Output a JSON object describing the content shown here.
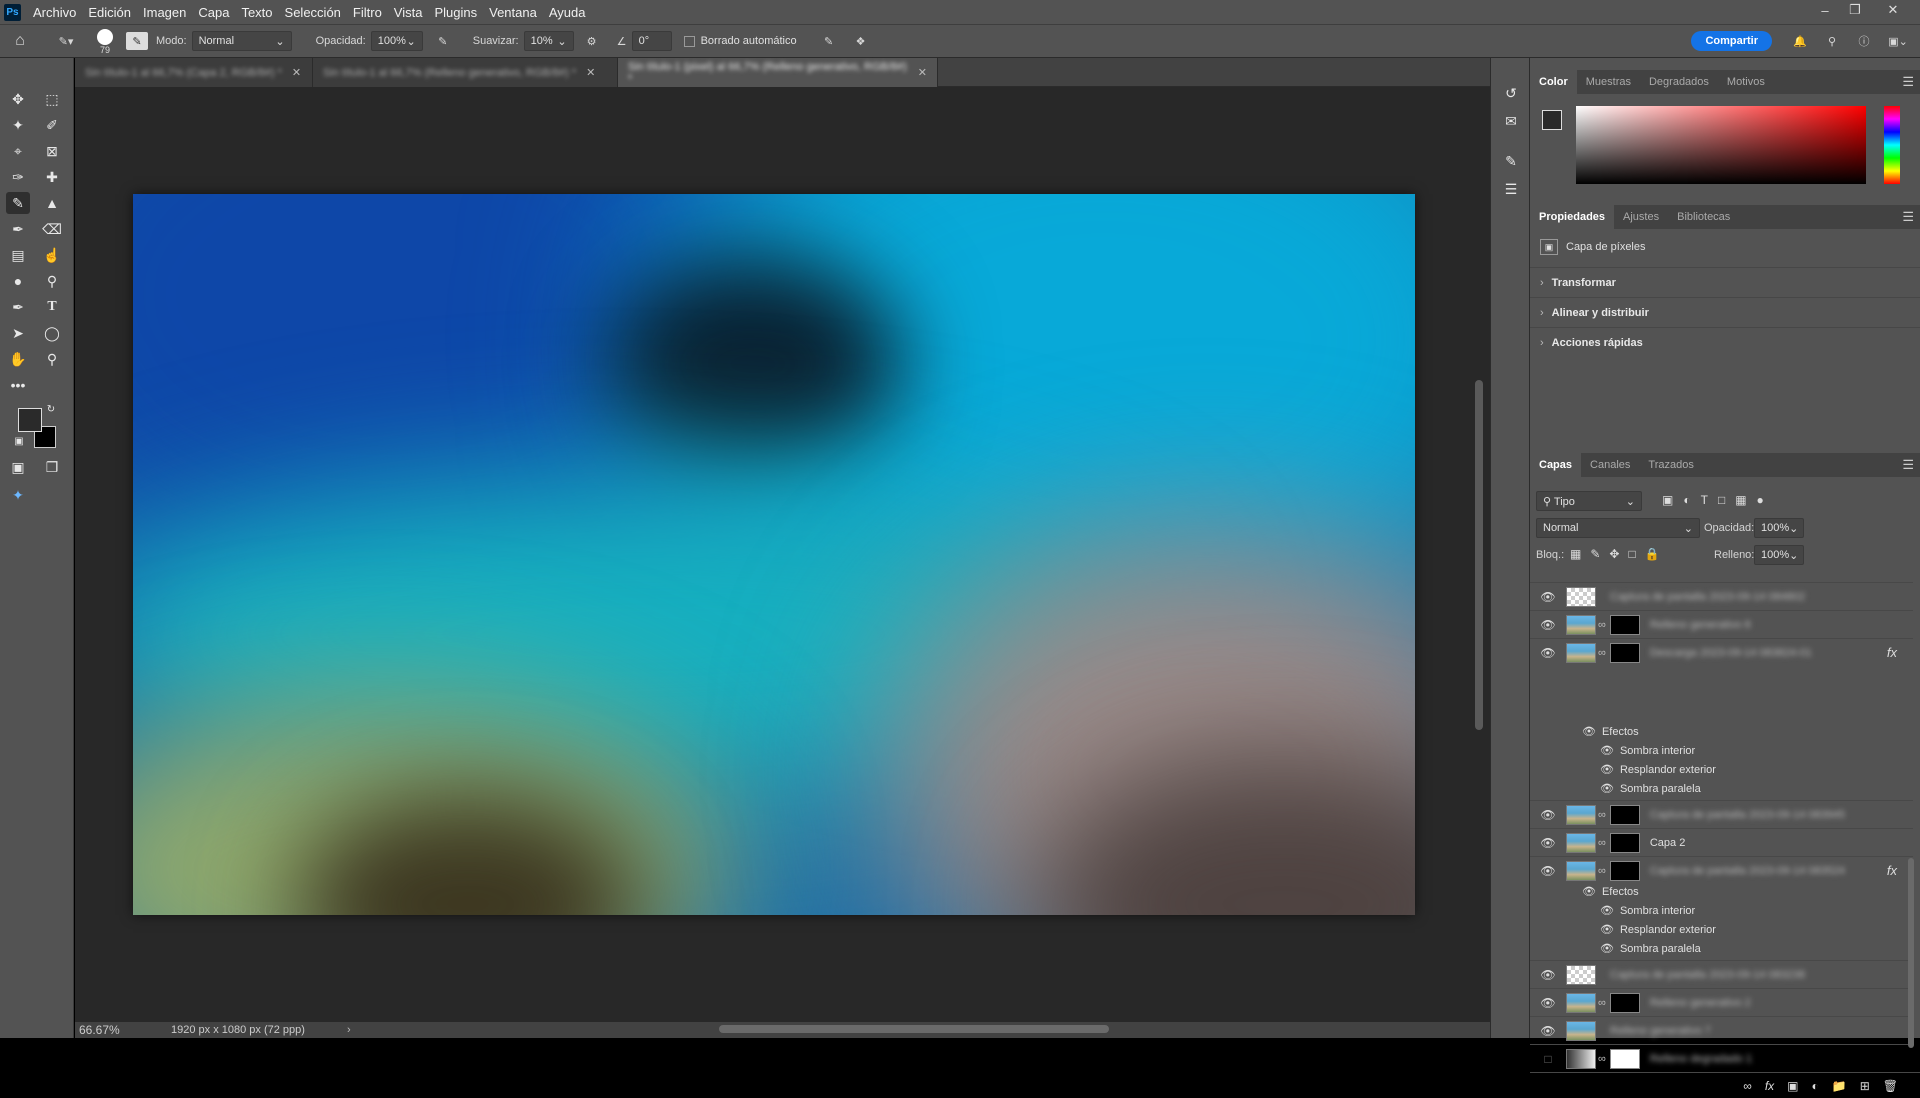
{
  "menubar": {
    "logo": "Ps",
    "items": [
      "Archivo",
      "Edición",
      "Imagen",
      "Capa",
      "Texto",
      "Selección",
      "Filtro",
      "Vista",
      "Plugins",
      "Ventana",
      "Ayuda"
    ]
  },
  "options": {
    "brush_size": "79",
    "mode_label": "Modo:",
    "mode_value": "Normal",
    "opacity_label": "Opacidad:",
    "opacity_value": "100%",
    "smooth_label": "Suavizar:",
    "smooth_value": "10%",
    "angle_value": "0°",
    "auto_erase_label": "Borrado automático",
    "share_label": "Compartir"
  },
  "doc_tabs": [
    {
      "label": "Sin título-1 al 66,7% (Capa 2, RGB/8#) *",
      "active": false
    },
    {
      "label": "Sin título-1 al 66,7% (Relleno generativo, RGB/8#) *",
      "active": false
    },
    {
      "label": "Sin título-1 (pixel) al 66,7% (Relleno generativo, RGB/8#) *",
      "active": true
    }
  ],
  "status": {
    "zoom": "66.67%",
    "doc_info": "1920 px x 1080 px (72 ppp)"
  },
  "color_panel": {
    "tabs": [
      "Color",
      "Muestras",
      "Degradados",
      "Motivos"
    ],
    "active": "Color"
  },
  "properties_panel": {
    "tabs": [
      "Propiedades",
      "Ajustes",
      "Bibliotecas"
    ],
    "active": "Propiedades",
    "layer_type": "Capa de píxeles",
    "sections": [
      "Transformar",
      "Alinear y distribuir",
      "Acciones rápidas"
    ]
  },
  "layers_panel": {
    "tabs": [
      "Capas",
      "Canales",
      "Trazados"
    ],
    "active": "Capas",
    "filter_label": "Tipo",
    "blend_mode": "Normal",
    "opacity_label": "Opacidad:",
    "opacity_value": "100%",
    "lock_label": "Bloq.:",
    "fill_label": "Relleno:",
    "fill_value": "100%",
    "effects_label": "Efectos",
    "effect_names": [
      "Sombra interior",
      "Resplandor exterior",
      "Sombra paralela"
    ],
    "layers": [
      {
        "name": "Captura de pantalla 2023-09-14 084802",
        "blurred": true
      },
      {
        "name": "Relleno generativo 8",
        "blurred": true
      },
      {
        "name": "Descarga 2023-09-14 083824-01",
        "blurred": true,
        "fx": true
      },
      {
        "name": "Captura de pantalla 2023-09-14 083945",
        "blurred": true
      },
      {
        "name": "Capa 2",
        "blurred": false
      },
      {
        "name": "Captura de pantalla 2023-09-14 083524",
        "blurred": true,
        "fx": true
      },
      {
        "name": "Captura de pantalla 2023-09-14 083238",
        "blurred": true
      },
      {
        "name": "Relleno generativo 2",
        "blurred": true
      },
      {
        "name": "Relleno generativo 7",
        "blurred": true
      },
      {
        "name": "Relleno degradado 1",
        "blurred": true
      }
    ]
  }
}
